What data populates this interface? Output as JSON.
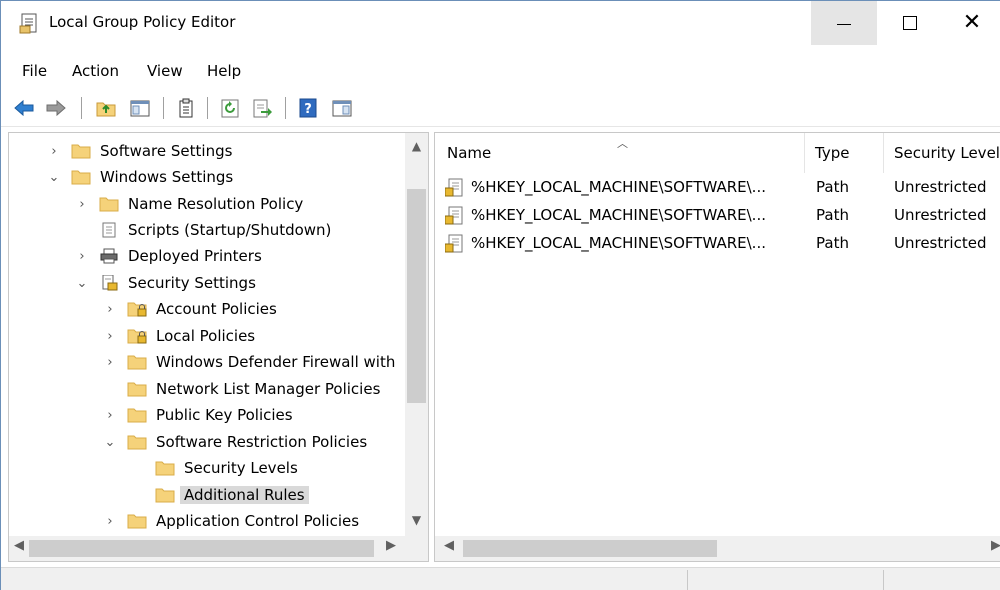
{
  "window": {
    "title": "Local Group Policy Editor",
    "icon": "policy-editor-icon"
  },
  "menu": [
    "File",
    "Action",
    "View",
    "Help"
  ],
  "toolbar": {
    "icons": [
      "back-arrow-icon",
      "forward-arrow-icon",
      "up-folder-icon",
      "show-hide-tree-icon",
      "export-list-icon",
      "refresh-icon",
      "export-icon",
      "help-icon",
      "show-action-pane-icon"
    ]
  },
  "tree": [
    {
      "label": "Software Settings",
      "expander": "collapsed",
      "icon": "folder-icon"
    },
    {
      "label": "Windows Settings",
      "expander": "expanded",
      "icon": "folder-icon"
    },
    {
      "label": "Name Resolution Policy",
      "expander": "collapsed",
      "icon": "folder-icon"
    },
    {
      "label": "Scripts (Startup/Shutdown)",
      "expander": "none",
      "icon": "script-icon"
    },
    {
      "label": "Deployed Printers",
      "expander": "collapsed",
      "icon": "printer-icon"
    },
    {
      "label": "Security Settings",
      "expander": "expanded",
      "icon": "security-settings-icon"
    },
    {
      "label": "Account Policies",
      "expander": "collapsed",
      "icon": "locked-folder-icon"
    },
    {
      "label": "Local Policies",
      "expander": "collapsed",
      "icon": "locked-folder-icon"
    },
    {
      "label": "Windows Defender Firewall with",
      "expander": "collapsed",
      "icon": "folder-icon"
    },
    {
      "label": "Network List Manager Policies",
      "expander": "none",
      "icon": "folder-icon"
    },
    {
      "label": "Public Key Policies",
      "expander": "collapsed",
      "icon": "folder-icon"
    },
    {
      "label": "Software Restriction Policies",
      "expander": "expanded",
      "icon": "folder-icon"
    },
    {
      "label": "Security Levels",
      "expander": "none",
      "icon": "folder-icon"
    },
    {
      "label": "Additional Rules",
      "expander": "none",
      "icon": "folder-icon",
      "selected": true
    },
    {
      "label": "Application Control Policies",
      "expander": "collapsed",
      "icon": "folder-icon"
    }
  ],
  "list": {
    "columns": [
      "Name",
      "Type",
      "Security Level"
    ],
    "rows": [
      {
        "name": "%HKEY_LOCAL_MACHINE\\SOFTWARE\\...",
        "type": "Path",
        "level": "Unrestricted"
      },
      {
        "name": "%HKEY_LOCAL_MACHINE\\SOFTWARE\\...",
        "type": "Path",
        "level": "Unrestricted"
      },
      {
        "name": "%HKEY_LOCAL_MACHINE\\SOFTWARE\\...",
        "type": "Path",
        "level": "Unrestricted"
      }
    ]
  },
  "colors": {
    "folder": "#f5d27a",
    "folder_edge": "#d9ac48",
    "selection": "#d9d9d9",
    "help_blue": "#2f6bbf",
    "refresh_green": "#3c9b3c"
  }
}
